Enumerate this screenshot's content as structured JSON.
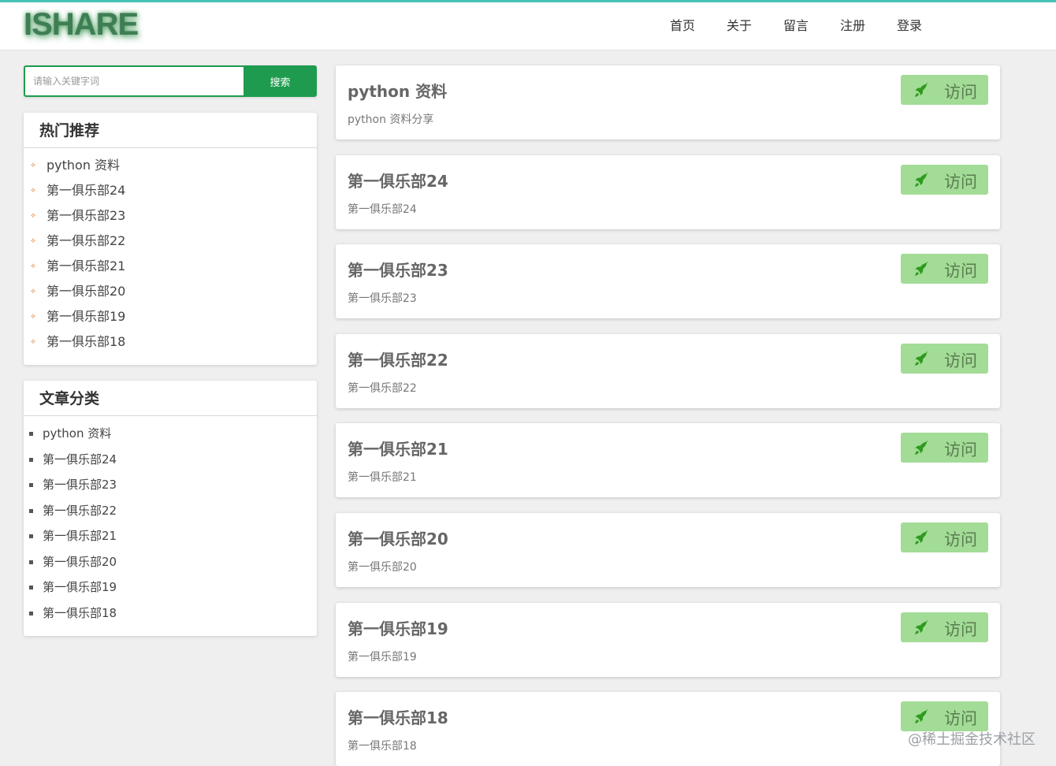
{
  "header": {
    "logo": "ISHARE",
    "nav": [
      "首页",
      "关于",
      "留言",
      "注册",
      "登录"
    ]
  },
  "search": {
    "placeholder": "请输入关键字词",
    "button": "搜索"
  },
  "hot": {
    "title": "热门推荐",
    "marker": "⟡",
    "items": [
      "python 资料",
      "第一俱乐部24",
      "第一俱乐部23",
      "第一俱乐部22",
      "第一俱乐部21",
      "第一俱乐部20",
      "第一俱乐部19",
      "第一俱乐部18"
    ]
  },
  "categories": {
    "title": "文章分类",
    "items": [
      "python 资料",
      "第一俱乐部24",
      "第一俱乐部23",
      "第一俱乐部22",
      "第一俱乐部21",
      "第一俱乐部20",
      "第一俱乐部19",
      "第一俱乐部18"
    ]
  },
  "cards": [
    {
      "title": "python 资料",
      "desc": "python 资料分享",
      "button": "访问"
    },
    {
      "title": "第一俱乐部24",
      "desc": "第一俱乐部24",
      "button": "访问"
    },
    {
      "title": "第一俱乐部23",
      "desc": "第一俱乐部23",
      "button": "访问"
    },
    {
      "title": "第一俱乐部22",
      "desc": "第一俱乐部22",
      "button": "访问"
    },
    {
      "title": "第一俱乐部21",
      "desc": "第一俱乐部21",
      "button": "访问"
    },
    {
      "title": "第一俱乐部20",
      "desc": "第一俱乐部20",
      "button": "访问"
    },
    {
      "title": "第一俱乐部19",
      "desc": "第一俱乐部19",
      "button": "访问"
    },
    {
      "title": "第一俱乐部18",
      "desc": "第一俱乐部18",
      "button": "访问"
    }
  ],
  "watermark": "@稀土掘金技术社区",
  "colors": {
    "brand_green": "#1e9b4e",
    "visit_button": "#a2dc96",
    "rocket_icon": "#2f9a1f",
    "hot_marker": "#e07a2b",
    "top_line": "#46c1b6",
    "page_background": "#efefef"
  },
  "icons": {
    "visit_button_icon": "rocket-icon",
    "hot_list_marker": "diamond-bullet-icon",
    "category_list_marker": "square-bullet-icon"
  }
}
